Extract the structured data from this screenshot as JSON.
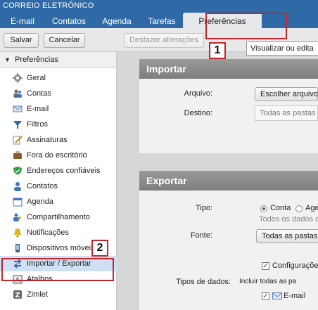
{
  "app": {
    "title": "CORREIO ELETRÔNICO"
  },
  "tabs": [
    {
      "label": "E-mail"
    },
    {
      "label": "Contatos"
    },
    {
      "label": "Agenda"
    },
    {
      "label": "Tarefas"
    },
    {
      "label": "Preferências",
      "active": true
    }
  ],
  "toolbar": {
    "save_label": "Salvar",
    "cancel_label": "Cancelar",
    "undo_label": "Desfazer alterações"
  },
  "tooltip": {
    "text": "Visualizar ou edita"
  },
  "sidebar": {
    "header": "Preferências",
    "items": [
      {
        "label": "Geral",
        "icon": "gear-icon"
      },
      {
        "label": "Contas",
        "icon": "accounts-icon"
      },
      {
        "label": "E-mail",
        "icon": "envelope-icon"
      },
      {
        "label": "Filtros",
        "icon": "filter-icon"
      },
      {
        "label": "Assinaturas",
        "icon": "signature-icon"
      },
      {
        "label": "Fora do escritório",
        "icon": "out-of-office-icon"
      },
      {
        "label": "Endereços confiáveis",
        "icon": "shield-icon"
      },
      {
        "label": "Contatos",
        "icon": "contact-icon"
      },
      {
        "label": "Agenda",
        "icon": "calendar-icon"
      },
      {
        "label": "Compartilhamento",
        "icon": "sharing-icon"
      },
      {
        "label": "Notificações",
        "icon": "bell-icon"
      },
      {
        "label": "Dispositivos móveis",
        "icon": "mobile-icon"
      },
      {
        "label": "Importar / Exportar",
        "icon": "import-export-icon",
        "selected": true
      },
      {
        "label": "Atalhos",
        "icon": "keyboard-icon"
      },
      {
        "label": "Zimlet",
        "icon": "zimlet-icon"
      }
    ]
  },
  "import": {
    "title": "Importar",
    "file_label": "Arquivo:",
    "file_button": "Escolher arquivo",
    "destination_label": "Destino:",
    "destination_value": "Todas as pastas"
  },
  "export": {
    "title": "Exportar",
    "type_label": "Tipo:",
    "type_option_account": "Conta",
    "type_option_other": "Age",
    "type_hint": "Todos os dados da",
    "source_label": "Fonte:",
    "source_value": "Todas as pastas",
    "settings_checkbox": "Configurações",
    "data_types_label": "Tipos de dados:",
    "data_types_hint": "Incluir todas as pa",
    "email_checkbox": "E-mail"
  },
  "annotations": {
    "one": "1",
    "two": "2"
  },
  "colors": {
    "header": "#2f6aa6",
    "annotation": "#c0272d",
    "selected": "#cfe0f5"
  }
}
